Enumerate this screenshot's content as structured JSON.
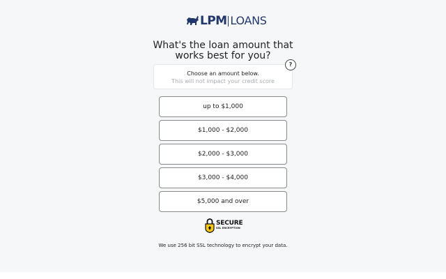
{
  "logo": {
    "bold": "LPM",
    "light": "LOANS",
    "color": "#23386a"
  },
  "question": {
    "line1": "What's the loan amount that",
    "line2": "works best for you?"
  },
  "info": {
    "title": "Choose an amount below.",
    "subtitle": "This will not impact your credit score",
    "help_label": "?"
  },
  "options": [
    {
      "label": "up to $1,000"
    },
    {
      "label": "$1,000 - $2,000"
    },
    {
      "label": "$2,000 - $3,000"
    },
    {
      "label": "$3,000 - $4,000"
    },
    {
      "label": "$5,000 and over"
    }
  ],
  "secure_badge": {
    "title": "SECURE",
    "subtitle": "SSL ENCRYPTION",
    "icon": "lock-icon",
    "accent": "#f5c518"
  },
  "footer": {
    "note": "We use 256 bit SSL technology to encrypt your data."
  }
}
